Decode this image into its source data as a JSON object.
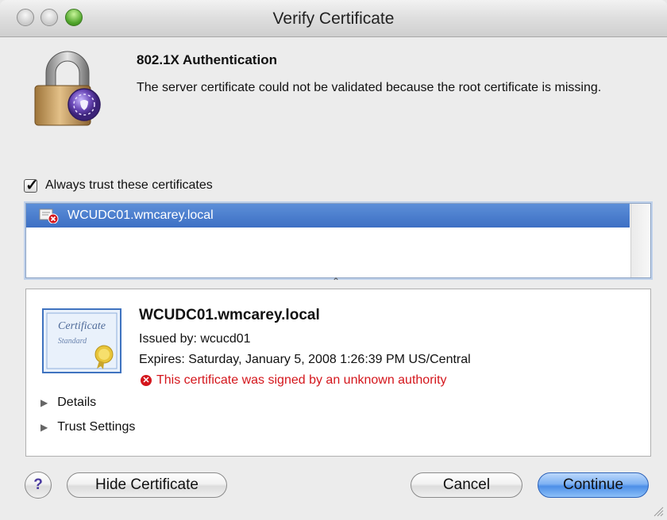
{
  "window": {
    "title": "Verify Certificate"
  },
  "header": {
    "title": "802.1X Authentication",
    "message": "The server certificate could not be validated because the root certificate is missing."
  },
  "trust": {
    "checked": true,
    "label": "Always trust these certificates"
  },
  "certificate_list": {
    "items": [
      {
        "label": "WCUDC01.wmcarey.local",
        "selected": true
      }
    ]
  },
  "certificate": {
    "name": "WCUDC01.wmcarey.local",
    "issued_by": "Issued by: wcucd01",
    "expires": "Expires: Saturday, January 5, 2008 1:26:39 PM US/Central",
    "warning": "This certificate was signed by an unknown authority",
    "image_text": [
      "Certificate",
      "Standard"
    ]
  },
  "disclosures": [
    {
      "label": "Details"
    },
    {
      "label": "Trust Settings"
    }
  ],
  "buttons": {
    "help": "?",
    "hide_certificate": "Hide Certificate",
    "cancel": "Cancel",
    "continue": "Continue"
  },
  "colors": {
    "selection": "#3c6fc4",
    "warning": "#d4161c",
    "default_button": "#4d8fe8"
  }
}
